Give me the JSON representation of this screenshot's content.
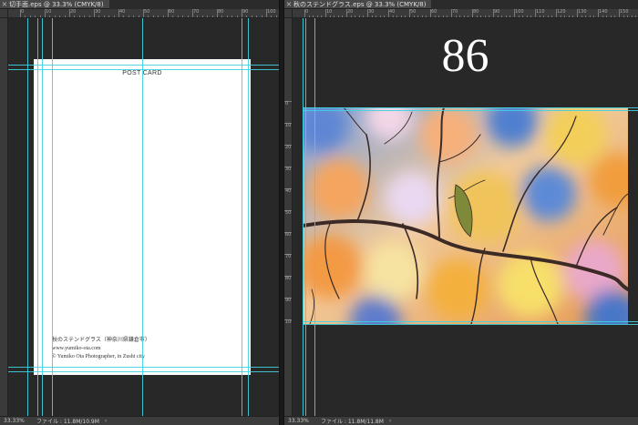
{
  "left_doc": {
    "tab_title": "切手面.eps @ 33.3% (CMYK/8)",
    "close_glyph": "×",
    "ruler_numbers_h": [
      "0",
      "10",
      "20",
      "30",
      "40",
      "50",
      "60",
      "70",
      "80",
      "90",
      "100"
    ],
    "postcard_title": "POST CARD",
    "credit_line_1": "秋のステンドグラス（神奈川県鎌倉市）",
    "credit_line_2": "www.yumiko-ota.com",
    "credit_line_3": "© Yumiko Ota Photographer, in Zushi city",
    "zoom": "33.33%",
    "file_info": "ファイル : 11.8M/10.9M",
    "arrow": "›"
  },
  "right_doc": {
    "tab_title": "秋のステンドグラス.eps @ 33.3% (CMYK/8)",
    "close_glyph": "×",
    "ruler_numbers_h": [
      "0",
      "10",
      "20",
      "30",
      "40",
      "50",
      "60",
      "70",
      "80",
      "90",
      "100",
      "110",
      "120",
      "130",
      "140",
      "150"
    ],
    "ruler_numbers_v": [
      "0",
      "10",
      "20",
      "30",
      "40",
      "50",
      "60",
      "70",
      "80",
      "90",
      "100"
    ],
    "big_number": "86",
    "zoom": "33.33%",
    "file_info": "ファイル : 11.8M/11.8M",
    "arrow": "›"
  },
  "colors": {
    "guide": "#3ed3e0",
    "panel": "#282828",
    "chrome": "#3a3a3a"
  },
  "icons": {
    "close": "close-icon",
    "arrow": "chevron-right-icon"
  }
}
